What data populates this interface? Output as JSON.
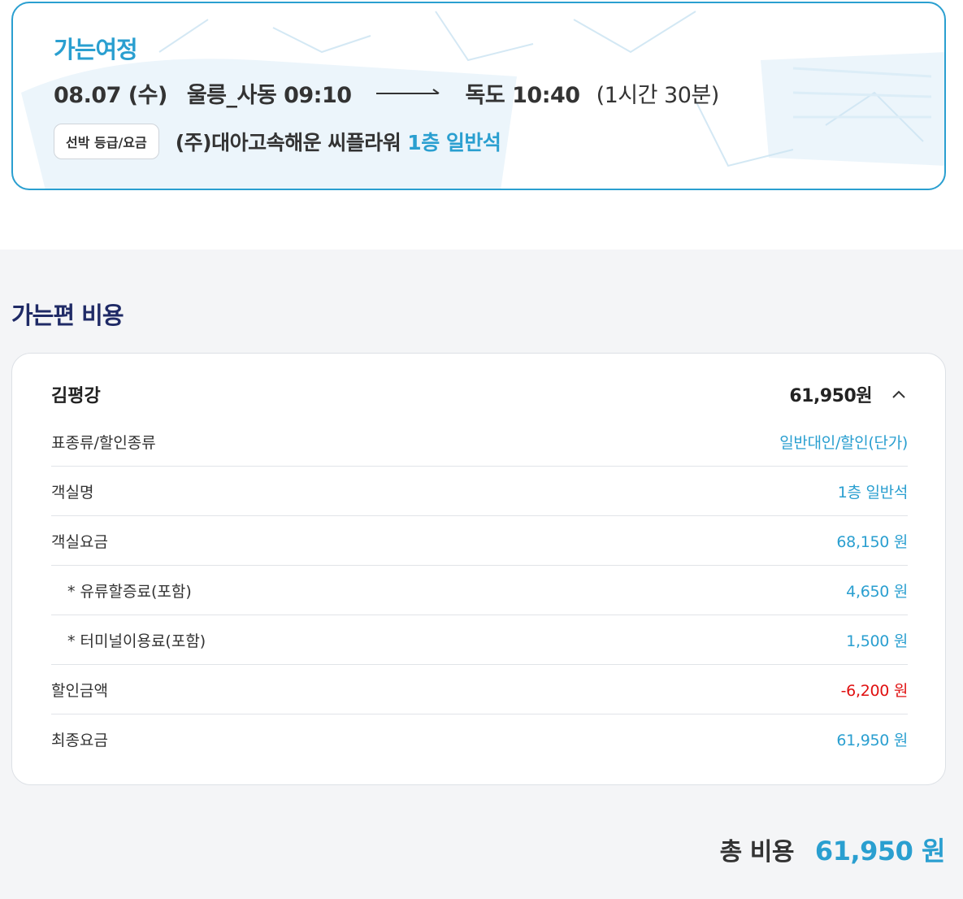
{
  "outbound": {
    "title": "가는여정",
    "date": "08.07 (수)",
    "departure": "울릉_사동 09:10",
    "arrival": "독도 10:40",
    "duration": "(1시간 30분)",
    "grade_badge": "선박 등급/요금",
    "company": "(주)대아고속해운 씨플라워",
    "seat_class": "1층 일반석"
  },
  "cost": {
    "section_title": "가는편 비용",
    "passenger": {
      "name": "김평강",
      "amount": "61,950원",
      "expand_icon": "chevron-up-icon"
    },
    "rows": [
      {
        "label": "표종류/할인종류",
        "value": "일반대인/할인(단가)"
      },
      {
        "label": "객실명",
        "value": "1층 일반석"
      },
      {
        "label": "객실요금",
        "value": "68,150 원"
      },
      {
        "label": "* 유류할증료(포함)",
        "value": "4,650 원"
      },
      {
        "label": "* 터미널이용료(포함)",
        "value": "1,500 원"
      },
      {
        "label": "할인금액",
        "value": "-6,200 원"
      },
      {
        "label": "최종요금",
        "value": "61,950 원"
      }
    ]
  },
  "total": {
    "label": "총 비용",
    "value": "61,950 원"
  },
  "colors": {
    "accent": "#2a9fd0",
    "heading": "#1f2a66",
    "discount": "#e01010",
    "section_bg": "#f4f5f7"
  }
}
